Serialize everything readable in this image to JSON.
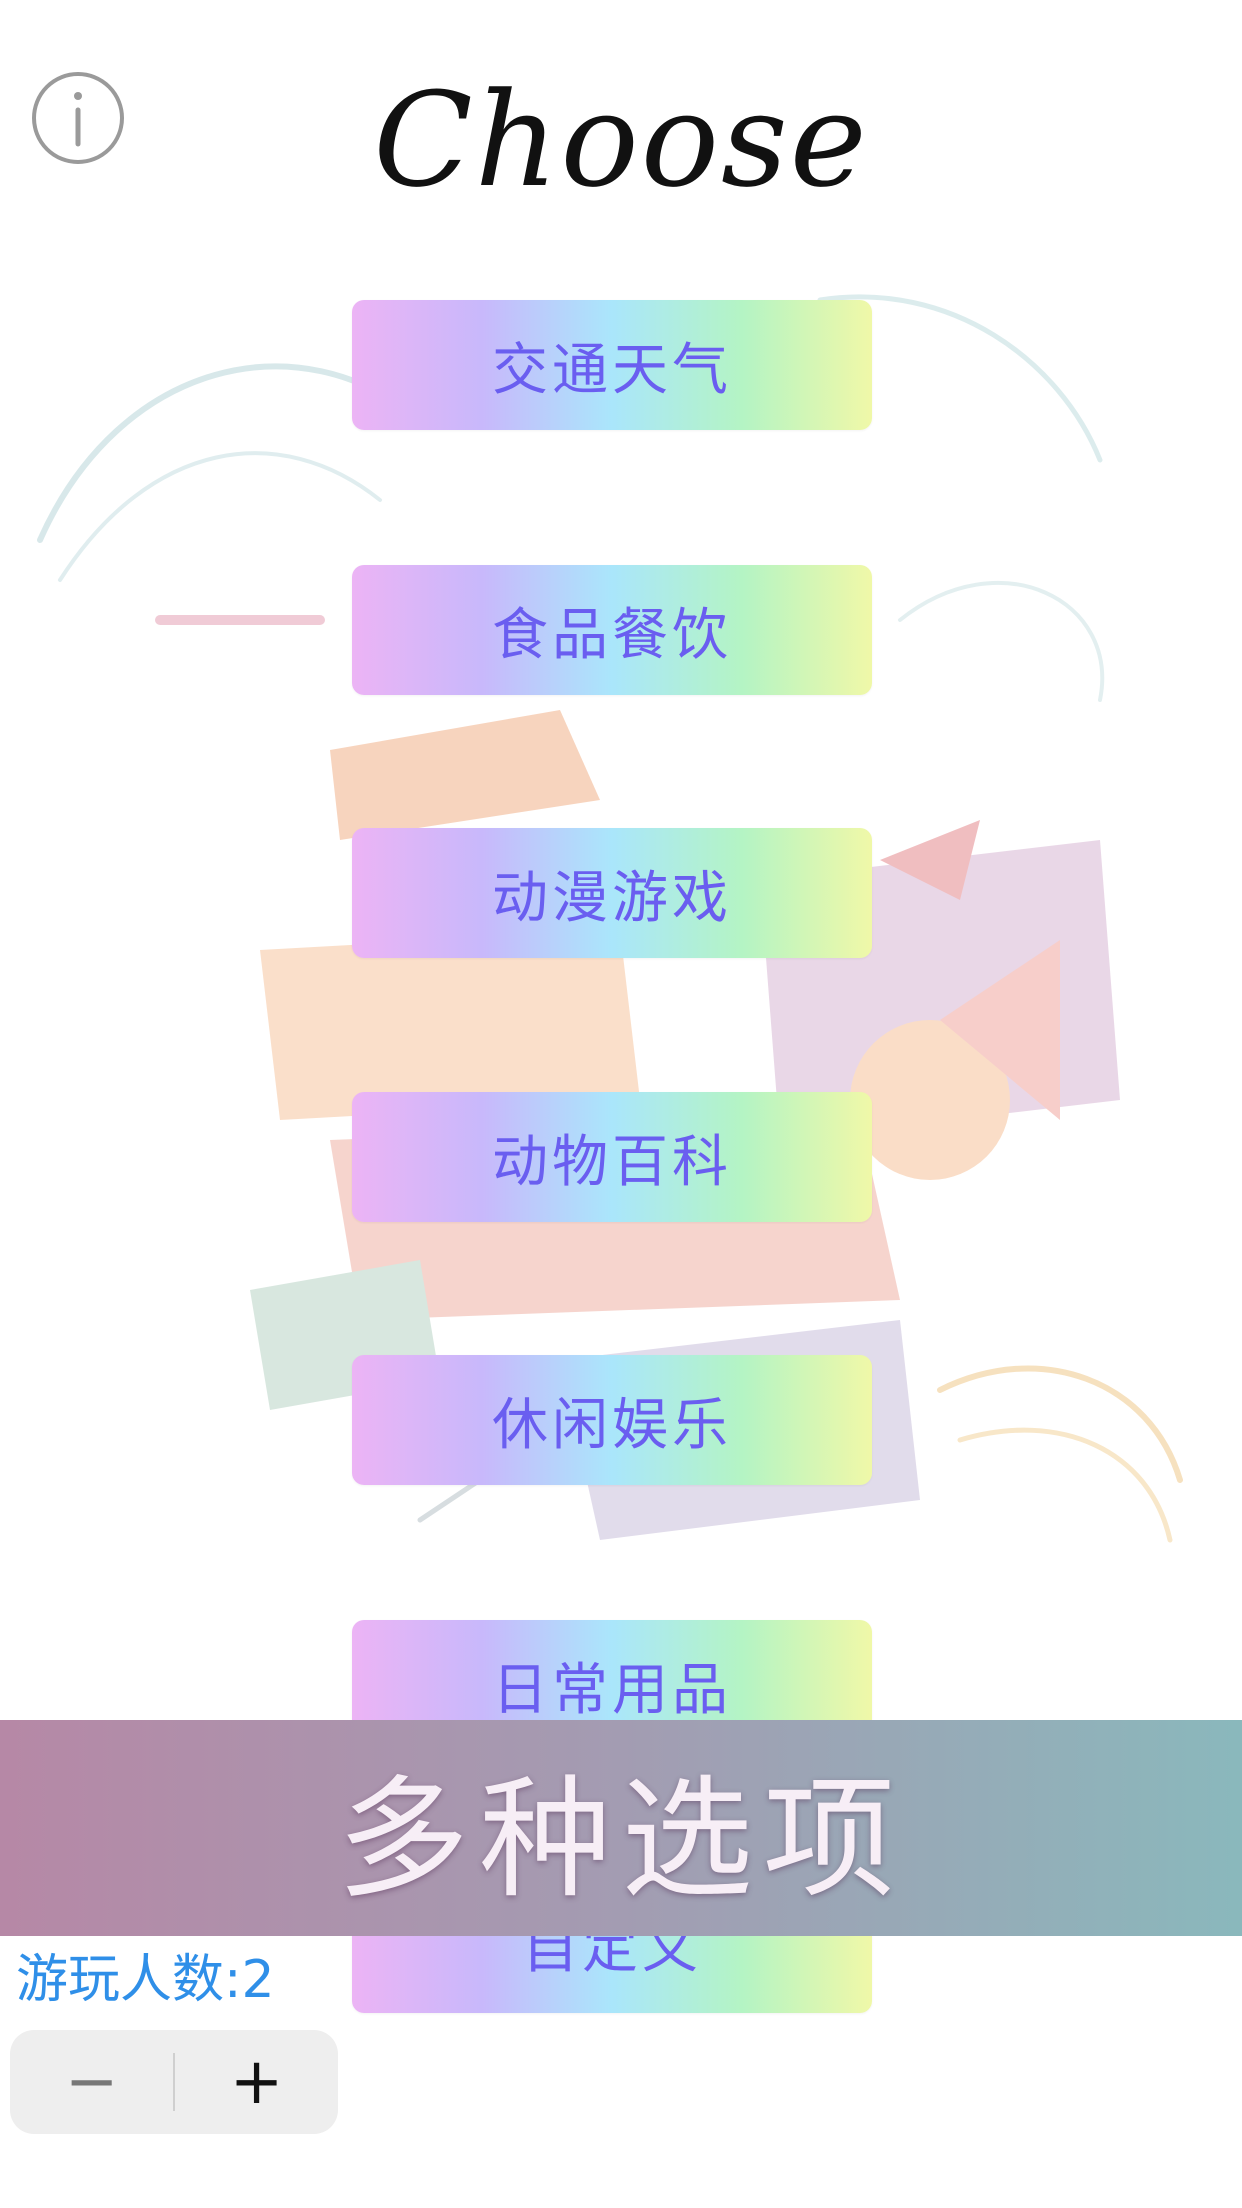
{
  "header": {
    "title": "Choose",
    "info_icon": "info-circle-icon"
  },
  "categories": [
    {
      "label": "交通天气"
    },
    {
      "label": "食品餐饮"
    },
    {
      "label": "动漫游戏"
    },
    {
      "label": "动物百科"
    },
    {
      "label": "休闲娱乐"
    },
    {
      "label": "日常用品"
    },
    {
      "label": "自定义"
    }
  ],
  "banner": {
    "text": "多种选项"
  },
  "players": {
    "label": "游玩人数:2",
    "minus_symbol": "−",
    "plus_symbol": "+"
  },
  "colors": {
    "button_text": "#6a5ef0",
    "player_text": "#2f8fe8",
    "banner_start": "#b688a6",
    "banner_end": "#8ab8bc"
  }
}
